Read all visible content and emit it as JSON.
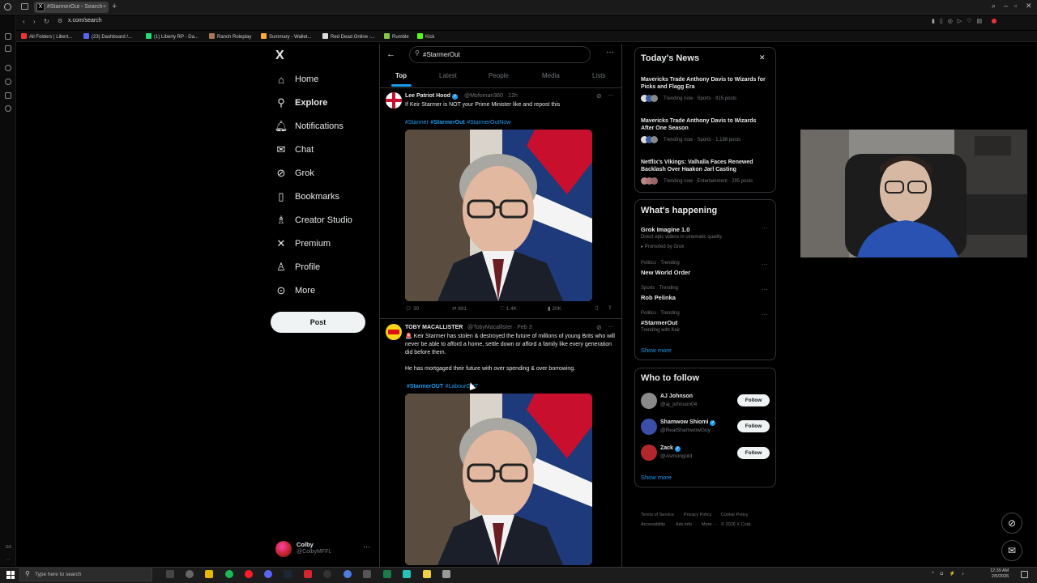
{
  "browser": {
    "tab_title": "#StarmerOut - Search",
    "url": "x.com/search",
    "bookmarks": [
      "All Folders | Libert...",
      "(23) Dashboard /...",
      "(1) Liberty RP - Da...",
      "Ranch Roleplay",
      "Summary - Wallet...",
      "Red Dead Online -...",
      "Rumble",
      "Kick"
    ]
  },
  "nav": {
    "logo": "X",
    "items": [
      {
        "label": "Home",
        "icon": "home-icon"
      },
      {
        "label": "Explore",
        "icon": "explore-icon"
      },
      {
        "label": "Notifications",
        "icon": "bell-icon"
      },
      {
        "label": "Chat",
        "icon": "mail-icon"
      },
      {
        "label": "Grok",
        "icon": "grok-icon"
      },
      {
        "label": "Bookmarks",
        "icon": "bookmark-icon"
      },
      {
        "label": "Creator Studio",
        "icon": "creator-icon"
      },
      {
        "label": "Premium",
        "icon": "x-icon"
      },
      {
        "label": "Profile",
        "icon": "person-icon"
      },
      {
        "label": "More",
        "icon": "more-icon"
      }
    ],
    "post_label": "Post",
    "account": {
      "name": "Colby",
      "handle": "@ColbyMFFL"
    }
  },
  "search": {
    "query": "#StarmerOut",
    "tabs": [
      "Top",
      "Latest",
      "People",
      "Media",
      "Lists"
    ]
  },
  "tweets": [
    {
      "name": "Lee Patriot Hood",
      "handle": "@Mofoman360 · 12h",
      "text": "If Keir Starmer is NOT your Prime Minister like and repost this",
      "hashtags": [
        "#Starmer",
        "#StarmerOut",
        "#StarmerOutNow"
      ],
      "stats": {
        "replies": "30",
        "reposts": "891",
        "likes": "1.4K",
        "views": "20K"
      }
    },
    {
      "name": "TOBY MACALLISTER",
      "handle": "@TobyMacallister · Feb 3",
      "text": "🚨 Keir Starmer has stolen & destroyed the future of millions of young Brits who will never be able to afford a home, settle down or afford a family like every generation did before them.",
      "text2": "He has mortgaged their future with over spending & over borrowing.",
      "hashtags": [
        "#StarmerOUT",
        "#LabourOUT"
      ]
    }
  ],
  "news": {
    "title": "Today's News",
    "items": [
      {
        "title": "Mavericks Trade Anthony Davis to Wizards for Picks and Flagg Era",
        "meta": "Trending now · Sports · 815 posts"
      },
      {
        "title": "Mavericks Trade Anthony Davis to Wizards After One Season",
        "meta": "Trending now · Sports · 1,188 posts"
      },
      {
        "title": "Netflix's Vikings: Valhalla Faces Renewed Backlash Over Haakon Jarl Casting",
        "meta": "Trending now · Entertainment · 295 posts"
      }
    ]
  },
  "happening": {
    "title": "What's happening",
    "items": [
      {
        "name": "Grok Imagine 1.0",
        "sub": "Direct epic videos in cinematic quality.",
        "meta2": "Promoted by Grok"
      },
      {
        "meta": "Politics · Trending",
        "name": "New World Order"
      },
      {
        "meta": "Sports · Trending",
        "name": "Rob Pelinka"
      },
      {
        "meta": "Politics · Trending",
        "name": "#StarmerOut",
        "sub": "Trending with Keir"
      }
    ],
    "show_more": "Show more"
  },
  "who_to_follow": {
    "title": "Who to follow",
    "users": [
      {
        "name": "AJ Johnson",
        "handle": "@aj_johnson04"
      },
      {
        "name": "Shamwow Shiomi",
        "handle": "@RealShamwowGuy"
      },
      {
        "name": "Zack",
        "handle": "@Asmongold"
      }
    ],
    "follow_label": "Follow",
    "show_more": "Show more"
  },
  "footer": [
    "Terms of Service",
    "Privacy Policy",
    "Cookie Policy",
    "Accessibility",
    "Ads info",
    "More ···",
    "© 2026 X Corp."
  ],
  "taskbar": {
    "search_placeholder": "Type here to search",
    "time": "12:39 AM",
    "date": "2/5/2026"
  }
}
